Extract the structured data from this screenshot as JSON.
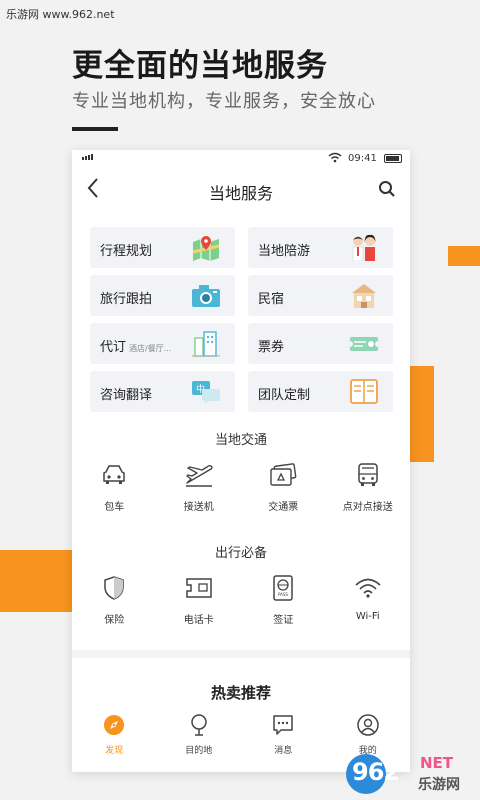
{
  "watermark": "乐游网 www.962.net",
  "headline": "更全面的当地服务",
  "subline": "专业当地机构，专业服务，安全放心",
  "status": {
    "time": "09:41"
  },
  "nav": {
    "title": "当地服务"
  },
  "tiles": [
    {
      "label": "行程规划",
      "sub": "",
      "icon": "map-icon"
    },
    {
      "label": "当地陪游",
      "sub": "",
      "icon": "guide-couple-icon"
    },
    {
      "label": "旅行跟拍",
      "sub": "",
      "icon": "camera-icon"
    },
    {
      "label": "民宿",
      "sub": "",
      "icon": "house-icon"
    },
    {
      "label": "代订",
      "sub": "酒店/餐厅...",
      "icon": "booking-icon"
    },
    {
      "label": "票券",
      "sub": "",
      "icon": "ticket-icon"
    },
    {
      "label": "咨询翻译",
      "sub": "",
      "icon": "translate-icon"
    },
    {
      "label": "团队定制",
      "sub": "",
      "icon": "team-book-icon"
    }
  ],
  "transport": {
    "title": "当地交通",
    "items": [
      "包车",
      "接送机",
      "交通票",
      "点对点接送"
    ]
  },
  "essentials": {
    "title": "出行必备",
    "items": [
      "保险",
      "电话卡",
      "签证",
      "Wi-Fi"
    ]
  },
  "hot": {
    "title": "热卖推荐"
  },
  "tabs": [
    {
      "label": "发现",
      "active": true
    },
    {
      "label": "目的地",
      "active": false
    },
    {
      "label": "消息",
      "active": false
    },
    {
      "label": "我的",
      "active": false
    }
  ],
  "logo": {
    "num": "962",
    "net": "NET",
    "cn": "乐游网"
  },
  "colors": {
    "accent": "#f7931e",
    "tile_bg": "#f1f3f6"
  }
}
